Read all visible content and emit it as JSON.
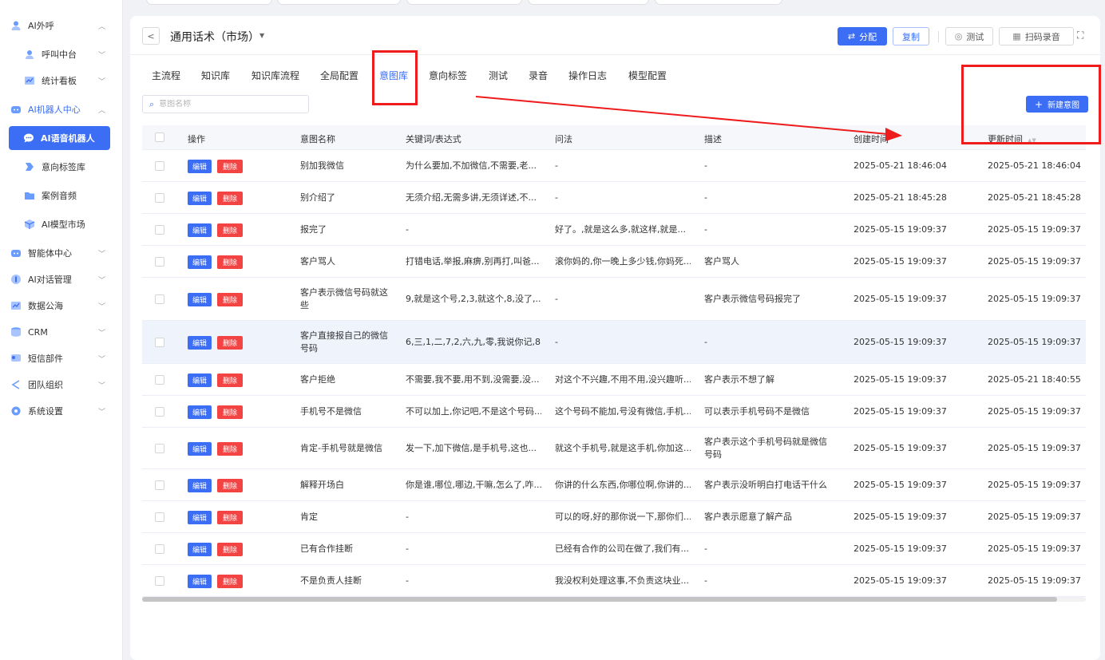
{
  "sidebar": {
    "items": [
      {
        "label": "AI外呼",
        "icon": "user-icon"
      },
      {
        "label": "呼叫中台",
        "icon": "headset-icon"
      },
      {
        "label": "统计看板",
        "icon": "chart-icon"
      },
      {
        "label": "AI机器人中心",
        "icon": "robot-icon"
      },
      {
        "label": "AI语音机器人",
        "icon": "chat-bubble-icon"
      },
      {
        "label": "意向标签库",
        "icon": "tag-icon"
      },
      {
        "label": "案例音频",
        "icon": "folder-icon"
      },
      {
        "label": "AI模型市场",
        "icon": "cube-icon"
      },
      {
        "label": "智能体中心",
        "icon": "agent-icon"
      },
      {
        "label": "AI对话管理",
        "icon": "dialog-icon"
      },
      {
        "label": "数据公海",
        "icon": "data-icon"
      },
      {
        "label": "CRM",
        "icon": "database-icon"
      },
      {
        "label": "短信部件",
        "icon": "message-icon"
      },
      {
        "label": "团队组织",
        "icon": "share-icon"
      },
      {
        "label": "系统设置",
        "icon": "gear-icon"
      }
    ]
  },
  "header": {
    "title": "通用话术（市场）",
    "assign_label": "分配",
    "copy_label": "复制",
    "test_label": "测试",
    "scan_label": "扫码录音"
  },
  "tabs": [
    "主流程",
    "知识库",
    "知识库流程",
    "全局配置",
    "意图库",
    "意向标签",
    "测试",
    "录音",
    "操作日志",
    "模型配置"
  ],
  "active_tab": "意图库",
  "search": {
    "placeholder": "意图名称",
    "value": ""
  },
  "new_button_label": "新建意图",
  "table": {
    "columns": [
      "操作",
      "意图名称",
      "关键词/表达式",
      "问法",
      "描述",
      "创建时间",
      "更新时间"
    ],
    "edit_label": "编辑",
    "delete_label": "删除",
    "rows": [
      {
        "name": "别加我微信",
        "keywords": "为什么要加,不加微信,不需要,老...",
        "question": "-",
        "desc": "-",
        "created": "2025-05-21 18:46:04",
        "updated": "2025-05-21 18:46:04"
      },
      {
        "name": "别介绍了",
        "keywords": "无须介绍,无需多讲,无须详述,不...",
        "question": "-",
        "desc": "-",
        "created": "2025-05-21 18:45:28",
        "updated": "2025-05-21 18:45:28"
      },
      {
        "name": "报完了",
        "keywords": "-",
        "question": "好了。,就是这么多,就这样,就是...",
        "desc": "-",
        "created": "2025-05-15 19:09:37",
        "updated": "2025-05-15 19:09:37"
      },
      {
        "name": "客户骂人",
        "keywords": "打错电话,举报,麻痹,别再打,叫爸...",
        "question": "滚你妈的,你一晚上多少钱,你妈死...",
        "desc": "客户骂人",
        "created": "2025-05-15 19:09:37",
        "updated": "2025-05-15 19:09:37"
      },
      {
        "name": "客户表示微信号码就这些",
        "keywords": "9,就是这个号,2,3,就这个,8,没了,...",
        "question": "-",
        "desc": "客户表示微信号码报完了",
        "created": "2025-05-15 19:09:37",
        "updated": "2025-05-15 19:09:37"
      },
      {
        "name": "客户直接报自己的微信号码",
        "keywords": "6,三,1,二,7,2,六,九,零,我说你记,8,...",
        "question": "-",
        "desc": "-",
        "created": "2025-05-15 19:09:37",
        "updated": "2025-05-15 19:09:37"
      },
      {
        "name": "客户拒绝",
        "keywords": "不需要,我不要,用不到,没需要,没...",
        "question": "对这个不兴趣,不用不用,没兴趣听...",
        "desc": "客户表示不想了解",
        "created": "2025-05-15 19:09:37",
        "updated": "2025-05-21 18:40:55"
      },
      {
        "name": "手机号不是微信",
        "keywords": "不可以加上,你记吧,不是这个号码...",
        "question": "这个号码不能加,号没有微信,手机...",
        "desc": "可以表示手机号码不是微信",
        "created": "2025-05-15 19:09:37",
        "updated": "2025-05-15 19:09:37"
      },
      {
        "name": "肯定-手机号就是微信",
        "keywords": "发一下,加下微信,是手机号,这也...",
        "question": "就这个手机号,就是这手机,你加这...",
        "desc": "客户表示这个手机号码就是微信号码",
        "created": "2025-05-15 19:09:37",
        "updated": "2025-05-15 19:09:37"
      },
      {
        "name": "解释开场白",
        "keywords": "你是谁,哪位,哪边,干嘛,怎么了,咋...",
        "question": "你讲的什么东西,你哪位啊,你讲的...",
        "desc": "客户表示没听明白打电话干什么",
        "created": "2025-05-15 19:09:37",
        "updated": "2025-05-15 19:09:37"
      },
      {
        "name": "肯定",
        "keywords": "-",
        "question": "可以的呀,好的那你说一下,那你们...",
        "desc": "客户表示愿意了解产品",
        "created": "2025-05-15 19:09:37",
        "updated": "2025-05-15 19:09:37"
      },
      {
        "name": "已有合作挂断",
        "keywords": "-",
        "question": "已经有合作的公司在做了,我们有...",
        "desc": "-",
        "created": "2025-05-15 19:09:37",
        "updated": "2025-05-15 19:09:37"
      },
      {
        "name": "不是负责人挂断",
        "keywords": "-",
        "question": "我没权利处理这事,不负责这块业...",
        "desc": "-",
        "created": "2025-05-15 19:09:37",
        "updated": "2025-05-15 19:09:37"
      }
    ]
  },
  "colors": {
    "primary": "#3b6ef5",
    "danger": "#f44343",
    "annotation": "#ee1c1c"
  }
}
